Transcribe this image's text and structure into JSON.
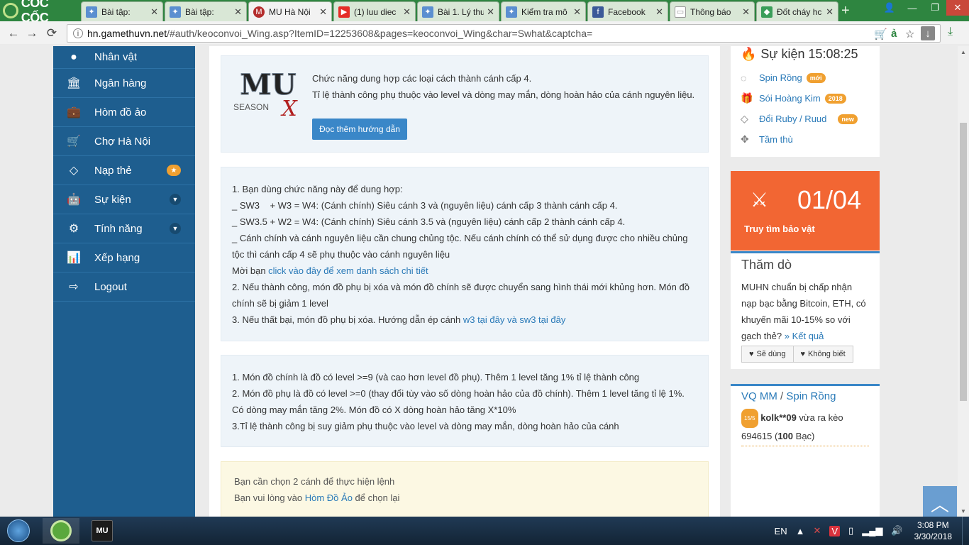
{
  "browser": {
    "logo_text": "CỐC CỐC",
    "tabs": [
      {
        "label": "Bài tập:",
        "active": false
      },
      {
        "label": "Bài tập:",
        "active": false
      },
      {
        "label": "MU Hà Nội",
        "active": true
      },
      {
        "label": "(1) luu diec",
        "active": false
      },
      {
        "label": "Bài 1. Lý thu",
        "active": false
      },
      {
        "label": "Kiểm tra mô",
        "active": false
      },
      {
        "label": "Facebook",
        "active": false
      },
      {
        "label": "Thông báo",
        "active": false
      },
      {
        "label": "Đốt cháy hc",
        "active": false
      }
    ],
    "url_host": "hn.gamethuvn.net",
    "url_rest": "/#auth/keoconvoi_Wing.asp?ItemID=12253608&pages=keoconvoi_Wing&char=Swhat&captcha="
  },
  "sidebar": {
    "items": [
      {
        "label": "Nhân vật",
        "icon": "user-icon"
      },
      {
        "label": "Ngân hàng",
        "icon": "bank-icon"
      },
      {
        "label": "Hòm đồ ảo",
        "icon": "briefcase-icon"
      },
      {
        "label": "Chợ Hà Nội",
        "icon": "cart-icon"
      },
      {
        "label": "Nạp thẻ",
        "icon": "diamond-icon"
      },
      {
        "label": "Sự kiện",
        "icon": "android-icon"
      },
      {
        "label": "Tính năng",
        "icon": "cogs-icon"
      },
      {
        "label": "Xếp hạng",
        "icon": "bar-chart-icon"
      },
      {
        "label": "Logout",
        "icon": "logout-icon"
      }
    ]
  },
  "intro": {
    "logo_text": "MU",
    "logo_sub": "SEASON",
    "logo_x": "X",
    "line1": "Chức năng dung hợp các loại cách thành cánh cấp 4.",
    "line2": "Tỉ lệ thành công phụ thuộc vào level và dòng may mắn, dòng hoàn hảo của cánh nguyên liệu.",
    "button": "Đọc thêm hướng dẫn"
  },
  "rules": {
    "l1": "1. Bạn dùng chức năng này để dung hợp:",
    "l2": "_ SW3    + W3 = W4: (Cánh chính) Siêu cánh 3 và (nguyên liệu) cánh cấp 3 thành cánh cấp 4.",
    "l3": "_ SW3.5 + W2 = W4: (Cánh chính) Siêu cánh 3.5 và (nguyên liệu) cánh cấp 2 thành cánh cấp 4.",
    "l4": "_ Cánh chính và cánh nguyên liệu cần chung chủng tộc. Nếu cánh chính có thể sử dụng được cho nhiều chủng tộc thì cánh cấp 4 sẽ phụ thuộc vào cánh nguyên liệu",
    "l5_prefix": "Mời bạn ",
    "l5_link": "click vào đây để xem danh sách chi tiết",
    "l6": "2. Nếu thành công, món đồ phụ bị xóa và món đồ chính sẽ được chuyển sang hình thái mới khủng hơn. Món đồ chính sẽ bị giảm 1 level",
    "l7_prefix": "3. Nếu thất bại, món đồ phụ bị xóa. Hướng dẫn ép cánh ",
    "l7_link": "w3 tại đây và sw3 tại đây"
  },
  "conditions": {
    "l1": "1. Món đồ chính là đồ có level >=9 (và cao hơn level đồ phụ). Thêm 1 level tăng 1% tỉ lệ thành công",
    "l2": "2. Món đồ phụ là đồ có level >=0 (thay đổi tùy vào số dòng hoàn hảo của đồ chính). Thêm 1 level tăng tỉ lệ 1%. Có dòng may mắn tăng 2%. Món đồ có X dòng hoàn hảo tăng X*10%",
    "l3": "3.Tỉ lệ thành công bị suy giảm phụ thuộc vào level và dòng may mắn, dòng hoàn hảo của cánh"
  },
  "warning": {
    "l1": "Bạn cần chọn 2 cánh để thực hiện lệnh",
    "l2_prefix": "Bạn vui lòng vào ",
    "l2_link": "Hòm Đồ Ảo",
    "l2_suffix": " để chọn lại"
  },
  "events": {
    "title": "Sự kiện 15:08:25",
    "items": [
      {
        "label": "Spin Rồng",
        "badge": "mới",
        "icon": "spinner-icon"
      },
      {
        "label": "Sói Hoàng Kim",
        "badge": "2018",
        "icon": "gift-icon"
      },
      {
        "label": "Đổi Ruby / Ruud",
        "badge": "new",
        "icon": "gem-icon"
      },
      {
        "label": "Tầm thù",
        "badge": "",
        "icon": "crosshair-icon"
      }
    ]
  },
  "treasure": {
    "count": "01/04",
    "label": "Truy tìm bảo vật"
  },
  "poll": {
    "title": "Thăm dò",
    "question": "MUHN chuẩn bị chấp nhận nạp bạc bằng Bitcoin, ETH, có khuyến mãi 10-15% so với gạch thẻ?",
    "result_link": "» Kết quả",
    "yes": "Sẽ dùng",
    "no": "Không biết"
  },
  "wheel": {
    "title_a": "VQ MM",
    "title_sep": " / ",
    "title_b": "Spin Rồng",
    "badge": "15/5",
    "player": "kolk**09",
    "text_mid": " vừa ra kèo 694615 (",
    "amount": "100",
    "text_end": " Bạc)"
  },
  "taskbar": {
    "lang": "EN",
    "time": "3:08 PM",
    "date": "3/30/2018",
    "mu_app_label": "MU"
  }
}
